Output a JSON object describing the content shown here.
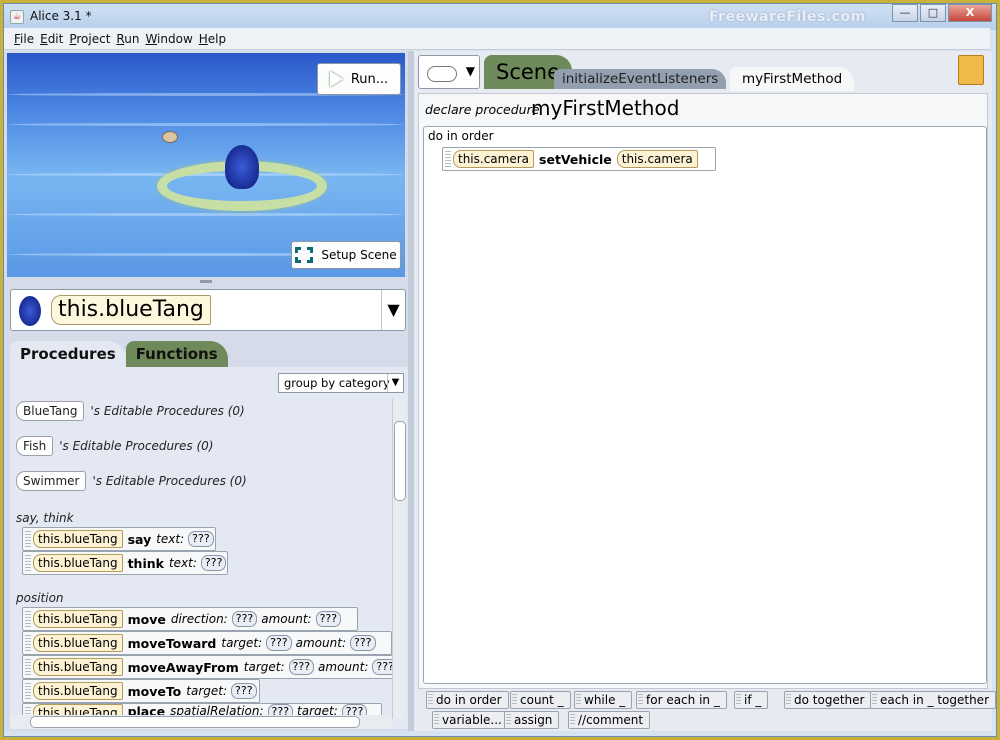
{
  "window": {
    "title": "Alice  3.1  *",
    "watermark": "FreewareFiles.com",
    "minimize": "—",
    "maximize": "□",
    "close": "X"
  },
  "menu": [
    "File",
    "Edit",
    "Project",
    "Run",
    "Window",
    "Help"
  ],
  "scene": {
    "run_label": "Run...",
    "setup_label": "Setup Scene"
  },
  "object_selector": {
    "value": "this.blueTang"
  },
  "left_tabs": {
    "procedures": "Procedures",
    "functions": "Functions"
  },
  "group_select": {
    "value": "group by category"
  },
  "editable_classes": [
    {
      "name": "BlueTang",
      "text": "'s Editable Procedures (0)"
    },
    {
      "name": "Fish",
      "text": "'s Editable Procedures (0)"
    },
    {
      "name": "Swimmer",
      "text": "'s Editable Procedures (0)"
    }
  ],
  "categories": {
    "say_think": "say, think",
    "position": "position"
  },
  "procedures": [
    {
      "target": "this.blueTang",
      "method": "say",
      "p1": "text:",
      "q1": "???",
      "p2": "",
      "q2": ""
    },
    {
      "target": "this.blueTang",
      "method": "think",
      "p1": "text:",
      "q1": "???",
      "p2": "",
      "q2": ""
    },
    {
      "target": "this.blueTang",
      "method": "move",
      "p1": "direction:",
      "q1": "???",
      "p2": "amount:",
      "q2": "???"
    },
    {
      "target": "this.blueTang",
      "method": "moveToward",
      "p1": "target:",
      "q1": "???",
      "p2": "amount:",
      "q2": "???"
    },
    {
      "target": "this.blueTang",
      "method": "moveAwayFrom",
      "p1": "target:",
      "q1": "???",
      "p2": "amount:",
      "q2": "???"
    },
    {
      "target": "this.blueTang",
      "method": "moveTo",
      "p1": "target:",
      "q1": "???",
      "p2": "",
      "q2": ""
    },
    {
      "target": "this.blueTang",
      "method": "place",
      "p1": "spatialRelation:",
      "q1": "???",
      "p2": "target:",
      "q2": "???"
    }
  ],
  "editor_tabs": {
    "scene": "Scene",
    "init": "initializeEventListeners",
    "current": "myFirstMethod"
  },
  "editor": {
    "declare": "declare procedure",
    "method_name": "myFirstMethod",
    "do_in_order": "do in order",
    "statement": {
      "target": "this.camera",
      "method": "setVehicle",
      "arg": "this.camera"
    }
  },
  "controls_row1": [
    "do in order",
    "count _",
    "while _",
    "for each in _",
    "if _",
    "do together",
    "each in _ together"
  ],
  "controls_row2": [
    "variable...",
    "assign",
    "//comment"
  ]
}
